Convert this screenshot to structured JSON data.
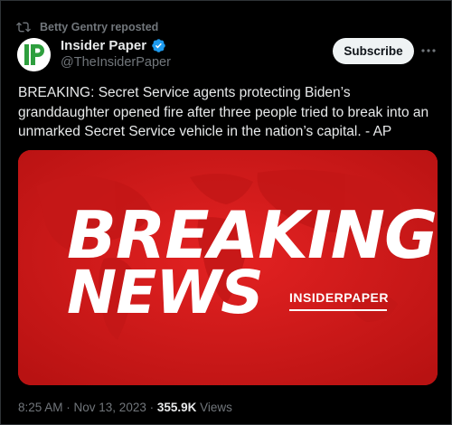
{
  "repost": {
    "text": "Betty Gentry reposted",
    "icon": "repost-icon"
  },
  "author": {
    "name": "Insider Paper",
    "handle": "@TheInsiderPaper",
    "verified_color": "#1d9bf0",
    "avatar_text": "IP",
    "avatar_color": "#2e9f3e"
  },
  "subscribe_label": "Subscribe",
  "more_icon": "more-dots-icon",
  "tweet": {
    "text": "BREAKING: Secret Service agents protecting Biden’s granddaughter opened fire after three people tried to break into an unmarked Secret Service vehicle in the nation’s capital. - AP"
  },
  "media": {
    "line1": "BREAKING",
    "line2": "NEWS",
    "brand": "INSIDERPAPER",
    "background": "#d71b1b"
  },
  "meta": {
    "time": "8:25 AM",
    "sep1": " · ",
    "date": "Nov 13, 2023",
    "sep2": " · ",
    "views_count": "355.9K",
    "views_label": " Views"
  }
}
